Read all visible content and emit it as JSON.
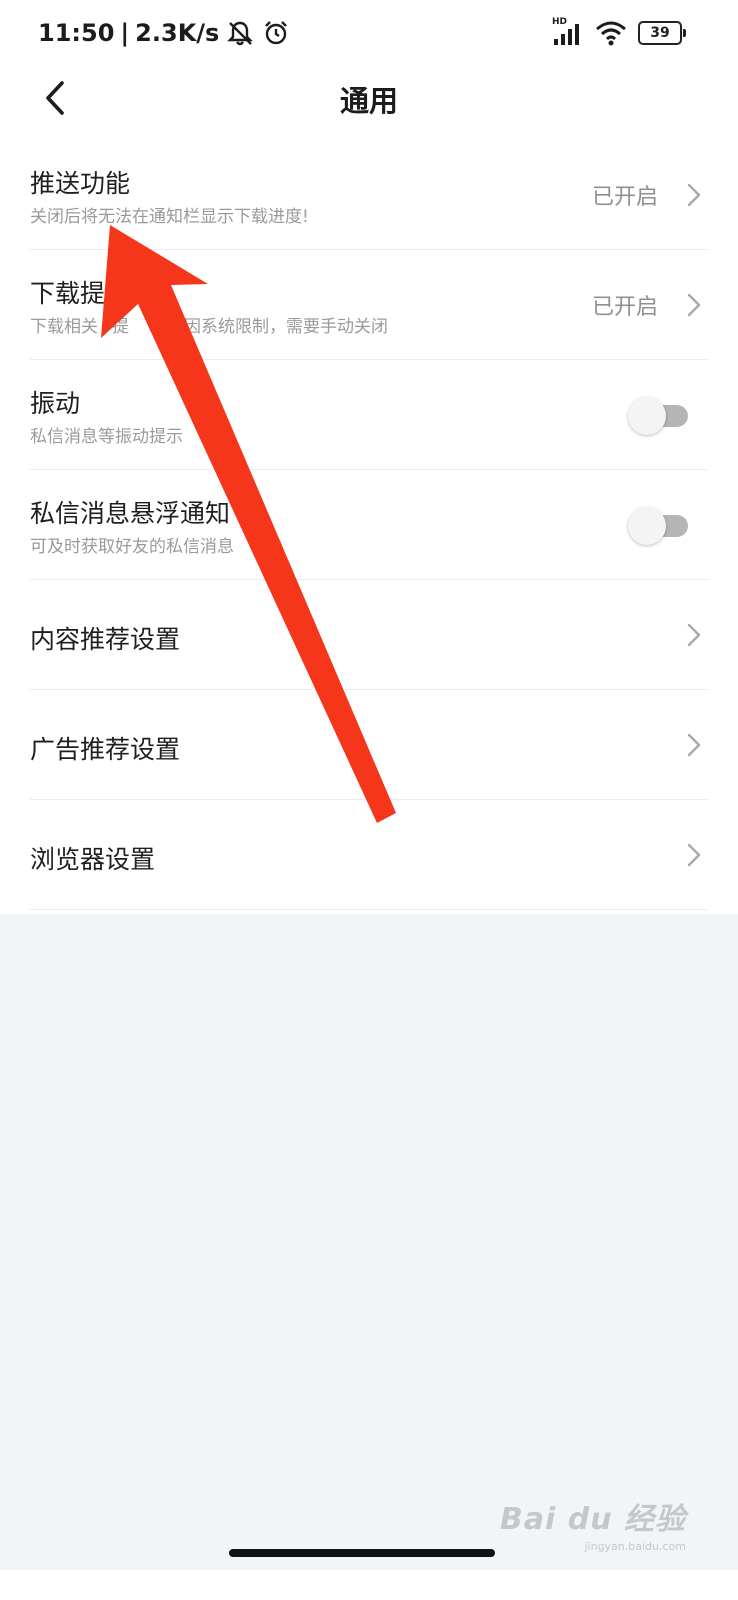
{
  "status_bar": {
    "time": "11:50",
    "separator": "|",
    "speed": "2.3K/s",
    "network_label": "HD",
    "battery_level": "39",
    "icons": [
      "bell-muted-icon",
      "alarm-icon",
      "cell-signal-icon",
      "wifi-icon",
      "battery-icon"
    ]
  },
  "header": {
    "title": "通用",
    "back_icon": "chevron-left-icon"
  },
  "settings": [
    {
      "title": "推送功能",
      "subtitle": "关闭后将无法在通知栏显示下载进度!",
      "value": "已开启",
      "control": "chevron"
    },
    {
      "title": "下载提",
      "subtitle": "下载相关",
      "subtitle_tail": "提",
      "subtitle_after": "，因系统限制，需要手动关闭",
      "value": "已开启",
      "control": "chevron"
    },
    {
      "title": "振动",
      "subtitle": "私信消息等振动提示",
      "control": "toggle",
      "on": false
    },
    {
      "title": "私信消息悬浮通知",
      "subtitle": "可及时获取好友的私信消息",
      "control": "toggle",
      "on": false
    },
    {
      "title": "内容推荐设置",
      "control": "chevron"
    },
    {
      "title": "广告推荐设置",
      "control": "chevron"
    },
    {
      "title": "浏览器设置",
      "control": "chevron"
    }
  ],
  "colors": {
    "annotation_arrow": "#f5361b",
    "toggle_track_off": "#b5b5b5",
    "page_bg_gray": "#f2f5f8"
  },
  "watermark": {
    "logo": "Bai du 经验",
    "url": "jingyan.baidu.com"
  }
}
